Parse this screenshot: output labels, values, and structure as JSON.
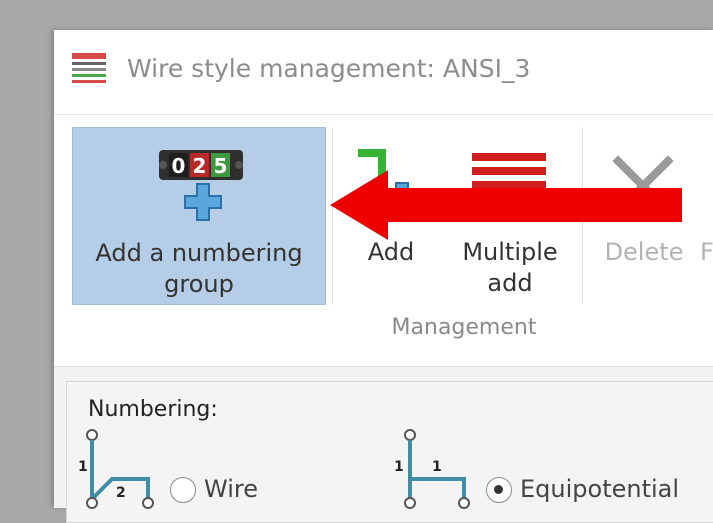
{
  "window": {
    "title": "Wire style management: ANSI_3",
    "title_icon": "wire-style-icon"
  },
  "ribbon": {
    "add_numbering_group": {
      "label": "Add a numbering group",
      "icon": "numbering-counter-add-icon",
      "counter_digits": [
        "0",
        "2",
        "5"
      ],
      "state": "highlighted"
    },
    "add": {
      "label": "Add",
      "icon": "wire-add-icon"
    },
    "multiple_add": {
      "label": "Multiple add",
      "icon": "multiple-wires-add-icon"
    },
    "delete": {
      "label": "Delete",
      "icon": "delete-x-icon",
      "disabled": true
    },
    "truncated_next": {
      "label": "F",
      "disabled": true
    },
    "group_label": "Management"
  },
  "numbering": {
    "label": "Numbering:",
    "options": [
      {
        "label": "Wire",
        "selected": false,
        "diagram_numbers": [
          "1",
          "2"
        ]
      },
      {
        "label": "Equipotential",
        "selected": true,
        "diagram_numbers": [
          "1",
          "1"
        ]
      }
    ]
  },
  "annotation": {
    "icon": "red-arrow-pointer-icon",
    "color": "#ee0000"
  },
  "colors": {
    "selected_button_bg": "#b5cde6",
    "wire_teal": "#3f8ea5",
    "add_green": "#35b335",
    "plus_blue": "#4b8fd1",
    "multi_red": "#d11f1f"
  }
}
